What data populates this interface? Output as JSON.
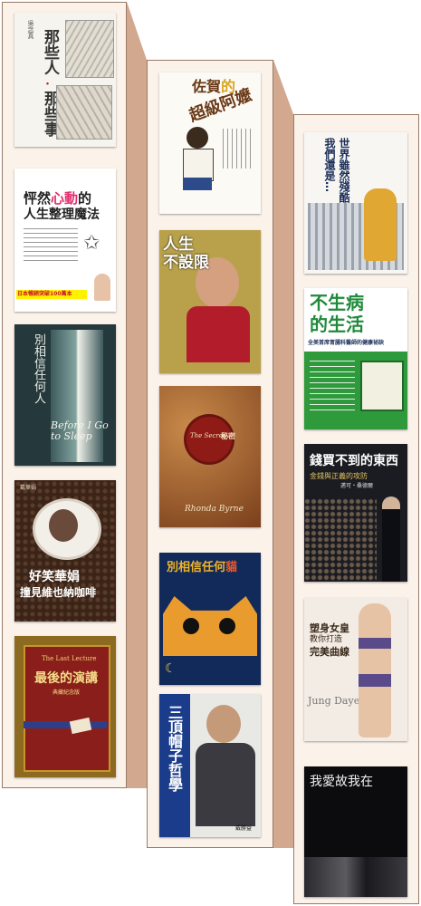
{
  "colors": {
    "panel": "#fbf2ea",
    "side": "#d2a88e",
    "border": "#9a7a66"
  },
  "books": [
    {
      "title": "那些人・那些事",
      "title_a": "那些人",
      "title_b": "那些事",
      "author": "吳念真"
    },
    {
      "title": "怦然心動的人生整理魔法",
      "title_line1_a": "怦然",
      "title_line1_b": "心動",
      "title_line1_c": "的",
      "title_line2": "人生整理魔法",
      "banner": "日本暢銷突破100萬本"
    },
    {
      "title": "別相信任何人",
      "english": "Before I Go to Sleep"
    },
    {
      "title": "好笑華娟撞見維也納咖啡",
      "line1": "好笑華娟",
      "line2": "撞見維也納咖啡",
      "author": "戴華娟"
    },
    {
      "title": "最後的演講",
      "english": "The Last Lecture",
      "subtitle": "典藏紀念版"
    },
    {
      "title": "佐賀的超級阿嬤",
      "title_a": "佐賀",
      "title_b": "的",
      "title_c": "超級",
      "title_d": "阿嬤"
    },
    {
      "title": "人生不設限",
      "title_line1": "人生",
      "title_line2": "不設限"
    },
    {
      "title": "秘密",
      "english": "The Secret",
      "author": "Rhonda Byrne"
    },
    {
      "title": "別相信任何貓",
      "title_a": "別相信任何",
      "title_b": "貓"
    },
    {
      "title": "三頂帽子哲學",
      "author": "戴勝益"
    },
    {
      "title": "世界雖然殘酷，我們還是…",
      "line1": "世界雖然殘酷",
      "line2": "我們還是…"
    },
    {
      "title": "不生病的生活",
      "line1": "不生病",
      "line2": "的生活",
      "subtitle": "全美首席胃腸科醫師的健康祕訣"
    },
    {
      "title": "錢買不到的東西",
      "subtitle": "金錢與正義的攻防",
      "author": "邁可・桑德爾"
    },
    {
      "title": "塑身女皇教你打造完美曲線",
      "line1": "塑身女皇",
      "line2": "教你打造",
      "line3": "完美曲線",
      "author": "Jung Dayeon"
    },
    {
      "title": "我愛故我在"
    }
  ]
}
